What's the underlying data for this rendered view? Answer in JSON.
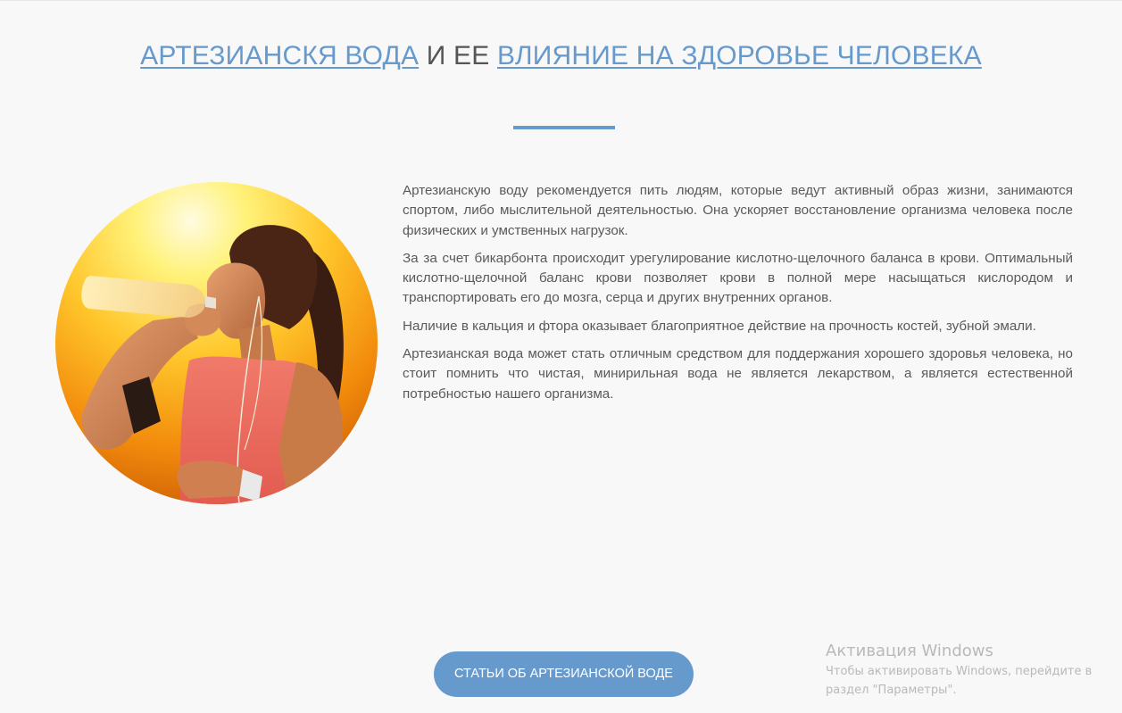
{
  "header": {
    "title_part1": "АРТЕЗИАНСКЯ ВОДА",
    "title_part2": " И ЕЕ ",
    "title_part3": "ВЛИЯНИЕ НА ЗДОРОВЬЕ ЧЕЛОВЕКА"
  },
  "article": {
    "paragraphs": [
      "Артезианскую воду рекомендуется пить людям, которые ведут активный образ жизни, занимаются спортом, либо мыслительной деятельностью. Она ускоряет восстановление организма человека после физических и умственных нагрузок.",
      "За за счет бикарбонта происходит урегулирование кислотно-щелочного баланса в крови. Оптимальный кислотно-щелочной баланс крови позволяет крови в полной мере насыщаться кислородом и транспортировать его до мозга, серца и других внутренних органов.",
      "Наличие в кальция и фтора оказывает благоприятное действие на прочность костей, зубной эмали.",
      "Артезианская вода может стать отличным средством для поддержания хорошего здоровья человека, но стоит помнить что чистая, минирильная вода не является лекарством, а является естественной потребностью нашего организма."
    ]
  },
  "cta": {
    "label": "СТАТЬИ ОБ АРТЕЗИАНСКОЙ ВОДЕ"
  },
  "watermark": {
    "title": "Активация Windows",
    "text": "Чтобы активировать Windows, перейдите в раздел \"Параметры\"."
  },
  "colors": {
    "accent": "#6699cc",
    "text": "#5a5a5a",
    "background": "#f8f8f8"
  }
}
